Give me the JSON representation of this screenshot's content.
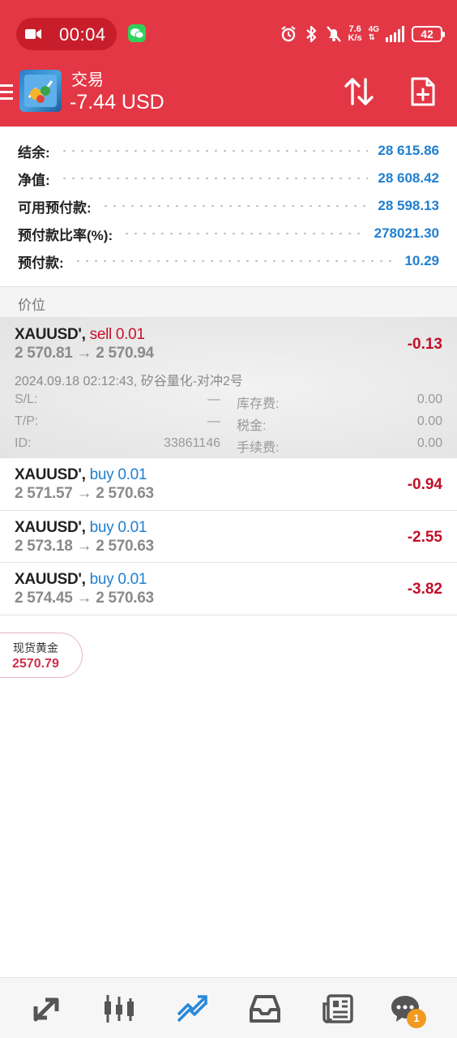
{
  "status_bar": {
    "recording_time": "00:04",
    "net_speed_value": "7.6",
    "net_speed_unit": "K/s",
    "network": "4G",
    "battery": "42"
  },
  "header": {
    "title": "交易",
    "profit": "-7.44 USD"
  },
  "account": [
    {
      "label": "结余:",
      "value": "28 615.86"
    },
    {
      "label": "净值:",
      "value": "28 608.42"
    },
    {
      "label": "可用预付款:",
      "value": "28 598.13"
    },
    {
      "label": "预付款比率(%):",
      "value": "278021.30"
    },
    {
      "label": "预付款:",
      "value": "10.29"
    }
  ],
  "section_title": "价位",
  "positions": [
    {
      "symbol": "XAUUSD',",
      "side": "sell 0.01",
      "prices": "2 570.81 → 2 570.94",
      "profit": "-0.13",
      "time_comment": "2024.09.18 02:12:43, 矽谷量化-对冲2号",
      "details": {
        "sl_label": "S/L:",
        "sl_value": "—",
        "swap_label": "库存费:",
        "swap_value": "0.00",
        "tp_label": "T/P:",
        "tp_value": "—",
        "tax_label": "税金:",
        "tax_value": "0.00",
        "id_label": "ID:",
        "id_value": "33861146",
        "fee_label": "手续费:",
        "fee_value": "0.00"
      }
    },
    {
      "symbol": "XAUUSD',",
      "side": "buy 0.01",
      "prices": "2 571.57 → 2 570.63",
      "profit": "-0.94"
    },
    {
      "symbol": "XAUUSD',",
      "side": "buy 0.01",
      "prices": "2 573.18 → 2 570.63",
      "profit": "-2.55"
    },
    {
      "symbol": "XAUUSD',",
      "side": "buy 0.01",
      "prices": "2 574.45 → 2 570.63",
      "profit": "-3.82"
    }
  ],
  "gold_widget": {
    "name": "现货黄金",
    "price": "2570.79"
  },
  "bottom_nav": {
    "items": [
      "quotes-icon",
      "chart-icon",
      "trade-icon",
      "history-icon",
      "news-icon",
      "chat-icon"
    ],
    "chat_badge": "1",
    "active_color": "#2a8ad8"
  },
  "colors": {
    "brand_red": "#e33745",
    "sell": "#c8102e",
    "buy": "#1f7fd0",
    "value_blue": "#1f7fd0"
  }
}
